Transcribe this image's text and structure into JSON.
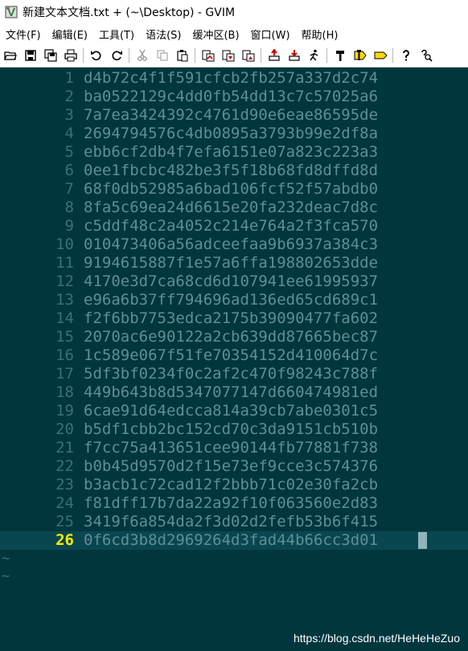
{
  "window": {
    "title": "新建文本文档.txt + (~\\Desktop) - GVIM"
  },
  "menu": [
    "文件(F)",
    "编辑(E)",
    "工具(T)",
    "语法(S)",
    "缓冲区(B)",
    "窗口(W)",
    "帮助(H)"
  ],
  "toolbar_icons": [
    "open-icon",
    "save-icon",
    "save-all-icon",
    "print-icon",
    "sep",
    "undo-icon",
    "redo-icon",
    "sep",
    "cut-icon",
    "copy-icon",
    "paste-icon",
    "sep",
    "find-replace-icon",
    "find-next-icon",
    "find-prev-icon",
    "sep",
    "load-session-icon",
    "save-session-icon",
    "run-script-icon",
    "sep",
    "make-icon",
    "run-ctags-icon",
    "tag-jump-icon",
    "sep",
    "help-icon",
    "find-help-icon"
  ],
  "editor": {
    "current_line": 26,
    "lines": [
      {
        "n": "1",
        "text": "d4b72c4f1f591cfcb2fb257a337d2c74"
      },
      {
        "n": "2",
        "text": "ba0522129c4dd0fb54dd13c7c57025a6"
      },
      {
        "n": "3",
        "text": "7a7ea3424392c4761d90e6eae86595de"
      },
      {
        "n": "4",
        "text": "2694794576c4db0895a3793b99e2df8a"
      },
      {
        "n": "5",
        "text": "ebb6cf2db4f7efa6151e07a823c223a3"
      },
      {
        "n": "6",
        "text": "0ee1fbcbc482be3f5f18b68fd8dffd8d"
      },
      {
        "n": "7",
        "text": "68f0db52985a6bad106fcf52f57abdb0"
      },
      {
        "n": "8",
        "text": "8fa5c69ea24d6615e20fa232deac7d8c"
      },
      {
        "n": "9",
        "text": "c5ddf48c2a4052c214e764a2f3fca570"
      },
      {
        "n": "10",
        "text": "010473406a56adceefaa9b6937a384c3"
      },
      {
        "n": "11",
        "text": "9194615887f1e57a6ffa198802653dde"
      },
      {
        "n": "12",
        "text": "4170e3d7ca68cd6d107941ee61995937"
      },
      {
        "n": "13",
        "text": "e96a6b37ff794696ad136ed65cd689c1"
      },
      {
        "n": "14",
        "text": "f2f6bb7753edca2175b39090477fa602"
      },
      {
        "n": "15",
        "text": "2070ac6e90122a2cb639dd87665bec87"
      },
      {
        "n": "16",
        "text": "1c589e067f51fe70354152d410064d7c"
      },
      {
        "n": "17",
        "text": "5df3bf0234f0c2af2c470f98243c788f"
      },
      {
        "n": "18",
        "text": "449b643b8d5347077147d660474981ed"
      },
      {
        "n": "19",
        "text": "6cae91d64edcca814a39cb7abe0301c5"
      },
      {
        "n": "20",
        "text": "b5df1cbb2bc152cd70c3da9151cb510b"
      },
      {
        "n": "21",
        "text": "f7cc75a413651cee90144fb77881f738"
      },
      {
        "n": "22",
        "text": "b0b45d9570d2f15e73ef9cce3c574376"
      },
      {
        "n": "23",
        "text": "b3acb1c72cad12f2bbb71c02e30fa2cb"
      },
      {
        "n": "24",
        "text": "f81dff17b7da22a92f10f063560e2d83"
      },
      {
        "n": "25",
        "text": "3419f6a854da2f3d02d2fefb53b6f415"
      },
      {
        "n": "26",
        "text": "0f6cd3b8d2969264d3fad44b66cc3d01"
      }
    ],
    "tilde_rows": [
      "~",
      "~"
    ]
  },
  "watermark": "https://blog.csdn.net/HeHeHeZuo",
  "colors": {
    "background": "#00363e",
    "line_number": "#3d6f77",
    "text": "#5e8e96",
    "current_line_number": "#ffea00",
    "cursorline": "#0a4650"
  }
}
